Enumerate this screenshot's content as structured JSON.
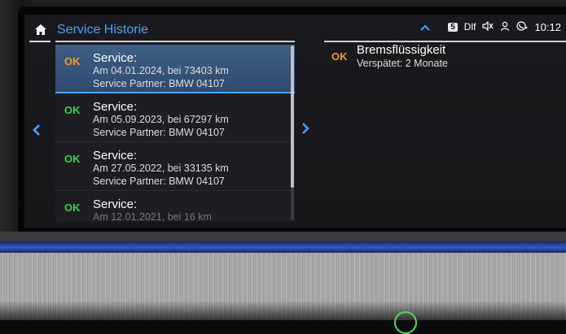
{
  "header": {
    "title": "Service Historie"
  },
  "status_bar": {
    "badge": "5",
    "label": "Dlf",
    "time": "10:12"
  },
  "list": [
    {
      "status": "OK",
      "status_color": "#f09a2a",
      "title": "Service:",
      "line1": "Am 04.01.2024, bei 73403 km",
      "line2": "Service Partner: BMW 04107"
    },
    {
      "status": "OK",
      "status_color": "#35d14a",
      "title": "Service:",
      "line1": "Am 05.09.2023, bei 67297 km",
      "line2": "Service Partner: BMW 04107"
    },
    {
      "status": "OK",
      "status_color": "#35d14a",
      "title": "Service:",
      "line1": "Am 27.05.2022, bei 33135 km",
      "line2": "Service Partner: BMW 04107"
    },
    {
      "status": "OK",
      "status_color": "#35d14a",
      "title": "Service:",
      "line1": "Am 12.01.2021, bei 16 km",
      "line2": ""
    }
  ],
  "detail": {
    "status": "OK",
    "title": "Bremsflüssigkeit",
    "subtitle": "Verspätet: 2 Monate"
  },
  "icons": {
    "home": "home-icon",
    "up": "chevron-up-icon",
    "mute": "speaker-mute-icon",
    "profile": "person-icon",
    "phone": "phone-icon",
    "left": "chevron-left-icon",
    "right": "chevron-right-icon"
  },
  "colors": {
    "accent_blue": "#4aa3ff",
    "ok_orange": "#f09a2a",
    "ok_green": "#35d14a"
  }
}
